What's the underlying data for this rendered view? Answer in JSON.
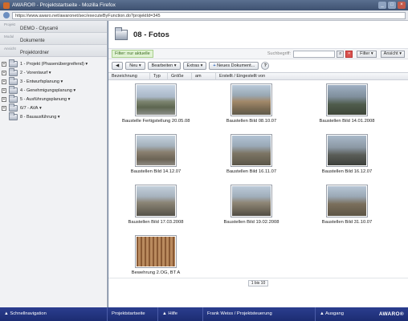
{
  "window": {
    "title": "AWARO® - Projektstartseite - Mozilla Firefox",
    "url": "https://www.awaro.net/awaronet/sec/executeByFunction.do?projektId=345"
  },
  "sidebar": {
    "project_caption": "Projekt",
    "project_value": "DEMO - Citycarré",
    "module_caption": "Modul",
    "module_value": "Dokumente",
    "view_caption": "Ansicht",
    "view_value": "Projektordner",
    "tree": [
      {
        "label": "1 - Projekt (Phasenübergreifend)",
        "expand": "+"
      },
      {
        "label": "2 - Vorentwurf",
        "expand": "+"
      },
      {
        "label": "3 - Entwurfsplanung",
        "expand": "+"
      },
      {
        "label": "4 - Genehmigungsplanung",
        "expand": "+"
      },
      {
        "label": "5 - Ausführungsplanung",
        "expand": "+"
      },
      {
        "label": "6/7 - AVA",
        "expand": "+"
      },
      {
        "label": "8 - Bauausführung",
        "expand": ""
      }
    ]
  },
  "main": {
    "title": "08 - Fotos",
    "filter_tag": "Filter: nur aktuelle",
    "search_label": "Suchbegriff:",
    "filter_button": "Filter",
    "view_button": "Ansicht",
    "back_button": "◀",
    "toolbar": {
      "new": "Neu",
      "edit": "Bearbeiten",
      "extras": "Extras",
      "new_doc": "Neues Dokument...",
      "help": "?"
    },
    "columns": [
      "Bezeichnung",
      "Typ",
      "Größe",
      "am",
      "Erstellt / Eingestellt von"
    ],
    "photos": [
      {
        "caption": "Baustelle Fertigstellung 20.05.08"
      },
      {
        "caption": "Baustellen Bild 08.10.07"
      },
      {
        "caption": "Baustellen Bild 14.01.2008"
      },
      {
        "caption": "Baustellen Bild 14.12.07"
      },
      {
        "caption": "Baustellen Bild 16.11.07"
      },
      {
        "caption": "Baustellen Bild 16.12.07"
      },
      {
        "caption": "Baustellen Bild 17.03.2008"
      },
      {
        "caption": "Baustellen Bild 19.02.2008"
      },
      {
        "caption": "Baustellen Bild 31.10.07"
      },
      {
        "caption": "Bewehrung 2.OG, BT A"
      }
    ],
    "pager": "1 bis 10"
  },
  "statusbar": {
    "quicknav": "Schnellnavigation",
    "home": "Projektstartseite",
    "help": "Hilfe",
    "user": "Frank Weiss / Projektsteuerung",
    "logout": "Ausgang",
    "logo": "AWARO®"
  }
}
